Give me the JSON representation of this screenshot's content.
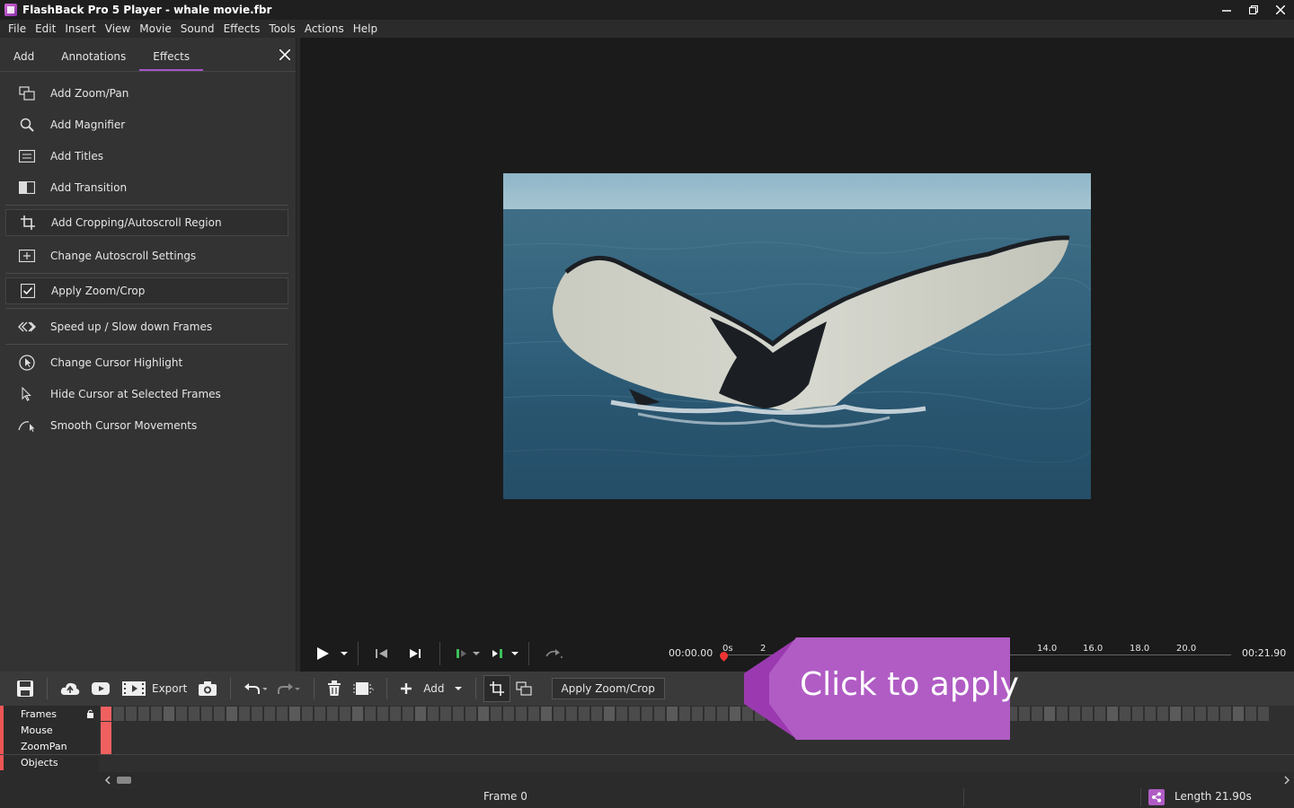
{
  "window": {
    "title": "FlashBack Pro 5 Player - whale movie.fbr",
    "controls": [
      "minimize-icon",
      "restore-icon",
      "close-icon"
    ]
  },
  "menu": [
    "File",
    "Edit",
    "Insert",
    "View",
    "Movie",
    "Sound",
    "Effects",
    "Tools",
    "Actions",
    "Help"
  ],
  "panel": {
    "tabs": [
      "Add",
      "Annotations",
      "Effects"
    ],
    "active_tab": "Effects",
    "items": [
      {
        "label": "Add Zoom/Pan",
        "icon": "zoom-pan-icon"
      },
      {
        "label": "Add Magnifier",
        "icon": "magnifier-icon"
      },
      {
        "label": "Add Titles",
        "icon": "titles-icon"
      },
      {
        "label": "Add Transition",
        "icon": "transition-icon"
      },
      {
        "label": "Add Cropping/Autoscroll Region",
        "icon": "crop-icon"
      },
      {
        "label": "Change Autoscroll Settings",
        "icon": "autoscroll-icon"
      },
      {
        "label": "Apply Zoom/Crop",
        "icon": "checkbox-icon"
      },
      {
        "label": "Speed up / Slow down Frames",
        "icon": "speed-icon"
      },
      {
        "label": "Change Cursor Highlight",
        "icon": "cursor-highlight-icon"
      },
      {
        "label": "Hide Cursor at Selected Frames",
        "icon": "cursor-icon"
      },
      {
        "label": "Smooth Cursor Movements",
        "icon": "smooth-cursor-icon"
      }
    ]
  },
  "playback": {
    "current_time": "00:00.00",
    "total_time": "00:21.90",
    "ticks": [
      "0s",
      "2",
      "14.0",
      "16.0",
      "18.0",
      "20.0"
    ]
  },
  "toolbar": {
    "export_label": "Export",
    "add_label": "Add",
    "apply_label": "Apply Zoom/Crop"
  },
  "timeline": {
    "tracks": [
      "Frames",
      "Mouse",
      "ZoomPan",
      "Objects"
    ]
  },
  "status": {
    "frame": "Frame 0",
    "length": "Length 21.90s"
  },
  "callout": {
    "text": "Click to apply",
    "color": "#b05cc4"
  }
}
